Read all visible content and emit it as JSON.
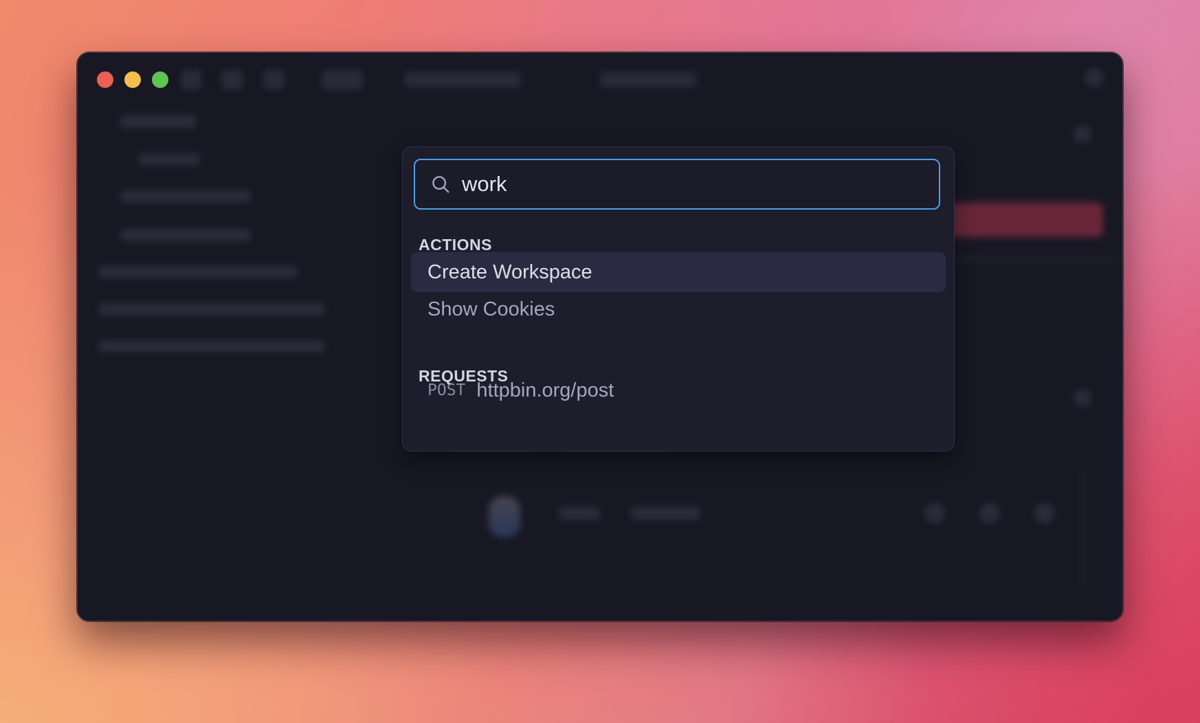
{
  "window": {
    "controls": [
      "close",
      "minimize",
      "maximize"
    ]
  },
  "palette": {
    "search": {
      "value": "work",
      "placeholder": ""
    },
    "sections": [
      {
        "label": "ACTIONS",
        "items": [
          {
            "label": "Create Workspace",
            "active": true
          },
          {
            "label": "Show Cookies",
            "active": false
          }
        ]
      },
      {
        "label": "REQUESTS",
        "items": [
          {
            "method": "POST",
            "label": "httpbin.org/post"
          }
        ]
      }
    ]
  },
  "colors": {
    "accent": "#4f9ee8",
    "active_item_bg": "#2b2a42",
    "window_bg": "#181824"
  }
}
